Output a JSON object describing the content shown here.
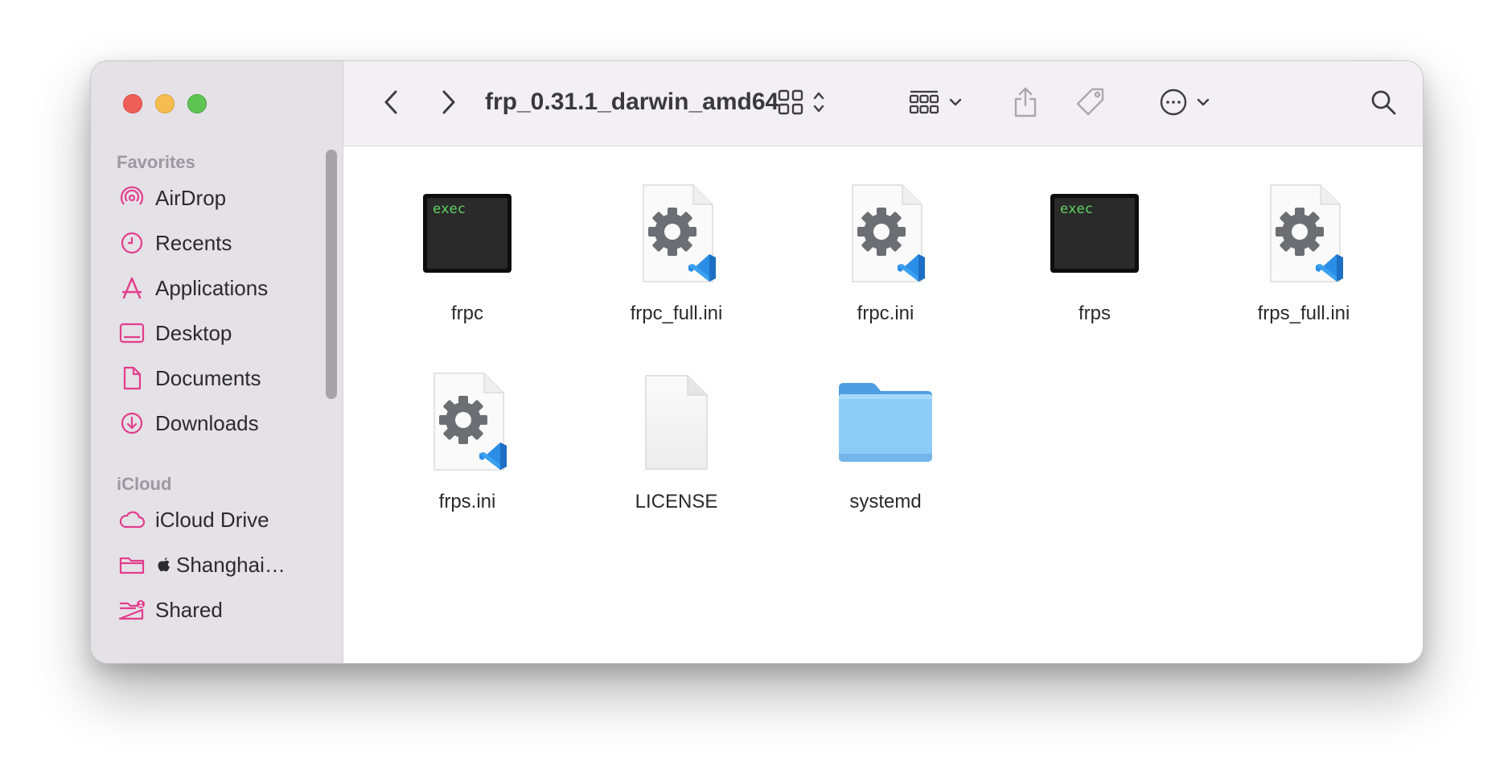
{
  "window": {
    "title": "frp_0.31.1_darwin_amd64"
  },
  "sidebar": {
    "sections": [
      {
        "header": "Favorites",
        "items": [
          {
            "label": "AirDrop",
            "icon": "airdrop-icon"
          },
          {
            "label": "Recents",
            "icon": "clock-icon"
          },
          {
            "label": "Applications",
            "icon": "applications-icon"
          },
          {
            "label": "Desktop",
            "icon": "desktop-icon"
          },
          {
            "label": "Documents",
            "icon": "document-icon"
          },
          {
            "label": "Downloads",
            "icon": "download-icon"
          }
        ]
      },
      {
        "header": "iCloud",
        "items": [
          {
            "label": "iCloud Drive",
            "icon": "cloud-icon"
          },
          {
            "label": "Shanghai…",
            "icon": "folder-icon"
          },
          {
            "label": "Shared",
            "icon": "shared-folder-icon"
          }
        ]
      }
    ]
  },
  "files": [
    {
      "name": "frpc",
      "kind": "exec",
      "badge": "exec"
    },
    {
      "name": "frpc_full.ini",
      "kind": "ini"
    },
    {
      "name": "frpc.ini",
      "kind": "ini"
    },
    {
      "name": "frps",
      "kind": "exec",
      "badge": "exec"
    },
    {
      "name": "frps_full.ini",
      "kind": "ini"
    },
    {
      "name": "frps.ini",
      "kind": "ini"
    },
    {
      "name": "LICENSE",
      "kind": "blank"
    },
    {
      "name": "systemd",
      "kind": "folder"
    }
  ],
  "colors": {
    "accent": "#e23d8c",
    "sidebar_bg": "#e4e1e7",
    "toolbar_bg": "#f2f0f5",
    "exec_text": "#5fd35f",
    "gear": "#6b6f73",
    "vscode_blue": "#2a8ee6",
    "folder_blue": "#8ccbf6"
  }
}
